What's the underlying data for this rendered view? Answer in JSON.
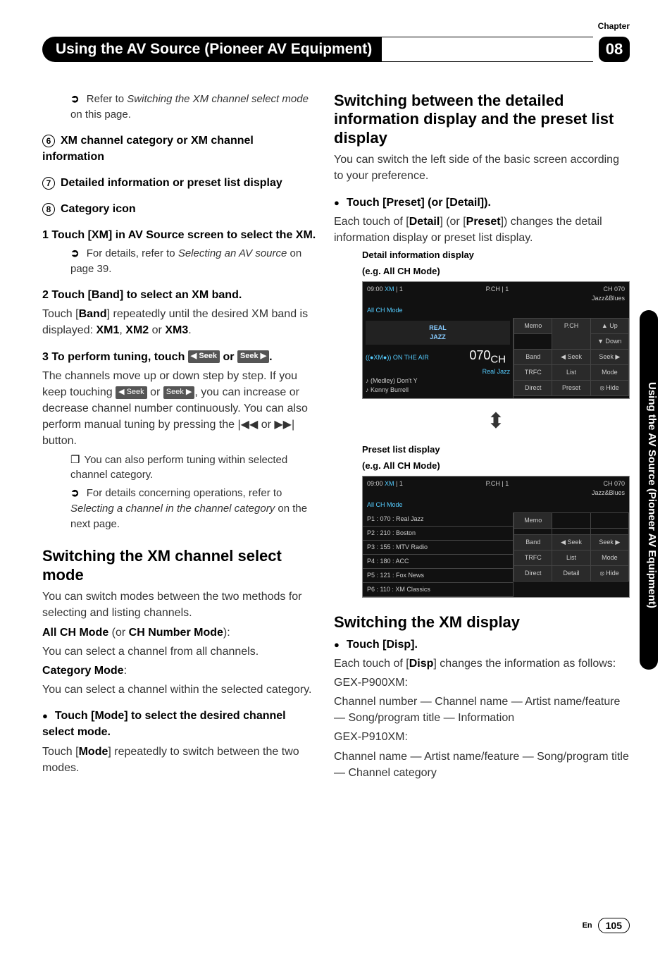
{
  "chapter_label": "Chapter",
  "chapter_number": "08",
  "header_title": "Using the AV Source (Pioneer AV Equipment)",
  "side_tab": "Using the AV Source (Pioneer AV Equipment)",
  "footer_lang": "En",
  "footer_page": "105",
  "left": {
    "ref_switch": "Refer to ",
    "ref_switch_em": "Switching the XM channel select mode",
    "ref_switch_tail": " on this page.",
    "item6": "XM channel category or XM channel information",
    "item7": "Detailed information or preset list display",
    "item8": "Category icon",
    "step1_head": "1   Touch [XM] in AV Source screen to select the XM.",
    "step1_ref": "For details, refer to ",
    "step1_ref_em": "Selecting an AV source",
    "step1_ref_tail": " on page 39.",
    "step2_head": "2   Touch [Band] to select an XM band.",
    "step2_body_a": "Touch [",
    "step2_body_b": "Band",
    "step2_body_c": "] repeatedly until the desired XM band is displayed: ",
    "step2_body_d": "XM1",
    "step2_body_e": ", ",
    "step2_body_f": "XM2",
    "step2_body_g": " or ",
    "step2_body_h": "XM3",
    "step2_body_i": ".",
    "step3_head_a": "3   To perform tuning, touch ",
    "step3_head_b": " or ",
    "step3_head_c": ".",
    "seek_left": "◀ Seek",
    "seek_right": "Seek ▶",
    "step3_body_a": "The channels move up or down step by step. If you keep touching ",
    "step3_body_b": " or ",
    "step3_body_c": ", you can increase or decrease channel number continuously. You can also perform manual tuning by pressing the ",
    "skip_prev": "|◀◀",
    "skip_or": " or ",
    "skip_next": "▶▶|",
    "step3_body_d": " button.",
    "step3_note1": "You can also perform tuning within selected channel category.",
    "step3_note2a": "For details concerning operations, refer to ",
    "step3_note2b": "Selecting a channel in the channel category",
    "step3_note2c": " on the next page.",
    "sec1_title": "Switching the XM channel select mode",
    "sec1_p1": "You can switch modes between the two methods for selecting and listing channels.",
    "sec1_l1a": "All CH Mode",
    "sec1_l1b": " (or ",
    "sec1_l1c": "CH Number Mode",
    "sec1_l1d": "):",
    "sec1_l1e": "You can select a channel from all channels.",
    "sec1_l2a": "Category Mode",
    "sec1_l2b": ":",
    "sec1_l2c": "You can select a channel within the selected category.",
    "sec1_step_a": "Touch [Mode] to select the desired channel select mode.",
    "sec1_step_b1": "Touch [",
    "sec1_step_b2": "Mode",
    "sec1_step_b3": "] repeatedly to switch between the two modes."
  },
  "right": {
    "sec2_title": "Switching between the detailed information display and the preset list display",
    "sec2_p1": "You can switch the left side of the basic screen according to your preference.",
    "sec2_step_head": "Touch [Preset] (or [Detail]).",
    "sec2_step_b1": "Each touch of [",
    "sec2_step_b2": "Detail",
    "sec2_step_b3": "] (or [",
    "sec2_step_b4": "Preset",
    "sec2_step_b5": "]) changes the detail information display or preset list display.",
    "cap_detail_1": "Detail information display",
    "cap_detail_2": "(e.g. All CH Mode)",
    "cap_preset_1": "Preset list display",
    "cap_preset_2": "(e.g. All CH Mode)",
    "sec3_title": "Switching the XM display",
    "sec3_step_head": "Touch [Disp].",
    "sec3_b1": "Each touch of [",
    "sec3_b2": "Disp",
    "sec3_b3": "] changes the information as follows:",
    "sec3_l1": "GEX-P900XM:",
    "sec3_l2": "Channel number — Channel name — Artist name/feature — Song/program title — Information",
    "sec3_l3": "GEX-P910XM:",
    "sec3_l4": "Channel name — Artist name/feature — Song/program title — Channel category"
  },
  "shot1": {
    "time": "09:00",
    "xm": "XM",
    "xmno": "1",
    "pch_lbl": "P.CH",
    "pch_no": "1",
    "ch": "CH 070",
    "cat": "Jazz&Blues",
    "mode": "All CH Mode",
    "onair": "((●XM●)) ON THE AIR",
    "chnum": "070",
    "chsuffix": "CH",
    "genre": "Real Jazz",
    "track": "(Medley) Don't Y",
    "artist": "Kenny Burrell",
    "btns": [
      "Memo",
      "P.CH",
      "▲ Up",
      "",
      "",
      "▼ Down",
      "Band",
      "◀ Seek",
      "Seek ▶",
      "TRFC",
      "List",
      "Mode",
      "Direct",
      "Preset",
      "⦻ Hide"
    ]
  },
  "shot2": {
    "time": "09:00",
    "xm": "XM",
    "xmno": "1",
    "pch_lbl": "P.CH",
    "pch_no": "1",
    "ch": "CH 070",
    "cat": "Jazz&Blues",
    "mode": "All CH Mode",
    "rows": [
      "P1 : 070 : Real Jazz",
      "P2 : 210 : Boston",
      "P3 : 155 : MTV Radio",
      "P4 : 180 : ACC",
      "P5 : 121 : Fox News",
      "P6 : 110 : XM Classics"
    ],
    "btns": [
      "Memo",
      "",
      "",
      "",
      "",
      "",
      "Band",
      "◀ Seek",
      "Seek ▶",
      "TRFC",
      "List",
      "Mode",
      "Direct",
      "Detail",
      "⦻ Hide"
    ]
  }
}
